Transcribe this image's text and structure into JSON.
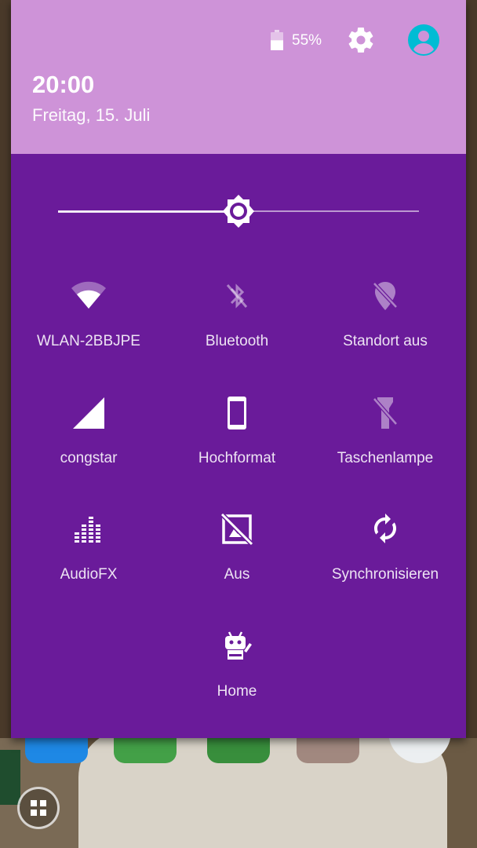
{
  "status": {
    "battery_percent": "55%",
    "battery_level": 0.55,
    "time": "20:00",
    "date": "Freitag, 15. Juli"
  },
  "brightness": {
    "level": 0.5
  },
  "tiles": [
    {
      "label": "WLAN-2BBJPE",
      "icon": "wifi-icon",
      "active": true
    },
    {
      "label": "Bluetooth",
      "icon": "bluetooth-off-icon",
      "active": false
    },
    {
      "label": "Standort aus",
      "icon": "location-off-icon",
      "active": false
    },
    {
      "label": "congstar",
      "icon": "cell-signal-icon",
      "active": true
    },
    {
      "label": "Hochformat",
      "icon": "portrait-phone-icon",
      "active": true
    },
    {
      "label": "Taschenlampe",
      "icon": "flashlight-off-icon",
      "active": false
    },
    {
      "label": "AudioFX",
      "icon": "equalizer-icon",
      "active": true
    },
    {
      "label": "Aus",
      "icon": "ambient-display-off-icon",
      "active": true
    },
    {
      "label": "Synchronisieren",
      "icon": "sync-icon",
      "active": true
    },
    {
      "label": "Home",
      "icon": "cyanogen-mascot-icon",
      "active": true
    }
  ],
  "colors": {
    "header": "#ce93d8",
    "panel": "#6a1b9a",
    "accent": "#00bcd4"
  }
}
